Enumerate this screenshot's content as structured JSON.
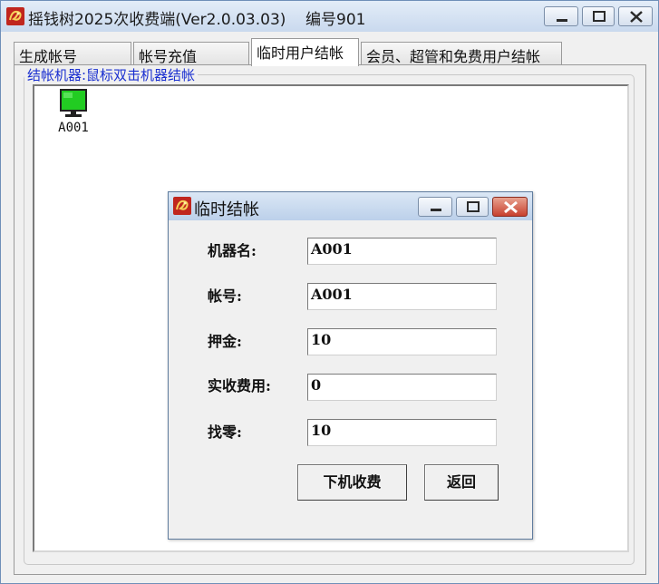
{
  "window": {
    "title": "摇钱树2025次收费端(Ver2.0.03.03)",
    "station": "编号901"
  },
  "tabs": [
    {
      "label": "生成帐号",
      "active": false
    },
    {
      "label": "帐号充值",
      "active": false
    },
    {
      "label": "临时用户结帐",
      "active": true
    },
    {
      "label": "会员、超管和免费用户结帐",
      "active": false
    }
  ],
  "group": {
    "legend": "结帐机器:鼠标双击机器结帐"
  },
  "machines": [
    {
      "label": "A001",
      "icon": "monitor-icon",
      "color": "#22cc22"
    }
  ],
  "dialog": {
    "title": "临时结帐",
    "fields": [
      {
        "label": "机器名:",
        "value": "A001"
      },
      {
        "label": "帐号:",
        "value": "A001"
      },
      {
        "label": "押金:",
        "value": "10"
      },
      {
        "label": "实收费用:",
        "value": "0"
      },
      {
        "label": "找零:",
        "value": "10"
      }
    ],
    "buttons": {
      "checkout": "下机收费",
      "back": "返回"
    }
  },
  "colors": {
    "legend_text": "#1a2fd0",
    "close_button": "#c8412f",
    "monitor_screen": "#22cc22"
  }
}
